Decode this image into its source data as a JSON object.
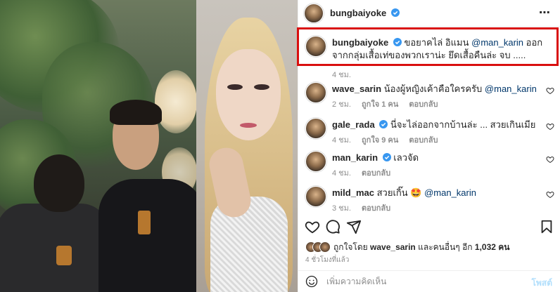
{
  "post": {
    "author": "bungbaiyoke",
    "caption": {
      "username": "bungbaiyoke",
      "text": "ขอยาคไล่ อิแมน",
      "mention": "@man_karin",
      "text2": "ออกจากกลุ่มเสื้อเท่ของพวกเราน่ะ ยึดเสื้อคืนล่ะ จบ .....",
      "time": "4 ชม."
    },
    "comments": [
      {
        "username": "wave_sarin",
        "text": "น้องผู้หญิงเค้าคือใครครับ",
        "mention": "@man_karin",
        "time": "2 ชม.",
        "likes": "ถูกใจ 1 คน",
        "reply": "ตอบกลับ"
      },
      {
        "username": "gale_rada",
        "text": "นี่จะไล่ออกจากบ้านล่ะ ... สวยเกินเมีย",
        "mention": "",
        "time": "4 ชม.",
        "likes": "ถูกใจ 9 คน",
        "reply": "ตอบกลับ"
      },
      {
        "username": "man_karin",
        "text": "เลวจัด",
        "mention": "",
        "time": "4 ชม.",
        "likes": "",
        "reply": "ตอบกลับ"
      },
      {
        "username": "mild_mac",
        "text": "สวยเกิ๊น 🤩",
        "mention": "@man_karin",
        "time": "3 ชม.",
        "likes": "",
        "reply": "ตอบกลับ"
      }
    ],
    "liked_by": {
      "prefix": "ถูกใจโดย",
      "user": "wave_sarin",
      "middle": "และคนอื่นๆ อีก",
      "count": "1,032 คน"
    },
    "time_ago": "4 ชั่วโมงที่แล้ว",
    "add_comment_placeholder": "เพิ่มความคิดเห็น",
    "post_button": "โพสต์"
  },
  "colors": {
    "highlight": "#d90f0f",
    "link": "#00376b",
    "verified": "#3897f0",
    "post_button": "#b2dffc"
  },
  "icons": [
    "more-icon",
    "verified-icon",
    "heart-icon",
    "comment-icon",
    "share-icon",
    "bookmark-icon",
    "emoji-icon"
  ]
}
